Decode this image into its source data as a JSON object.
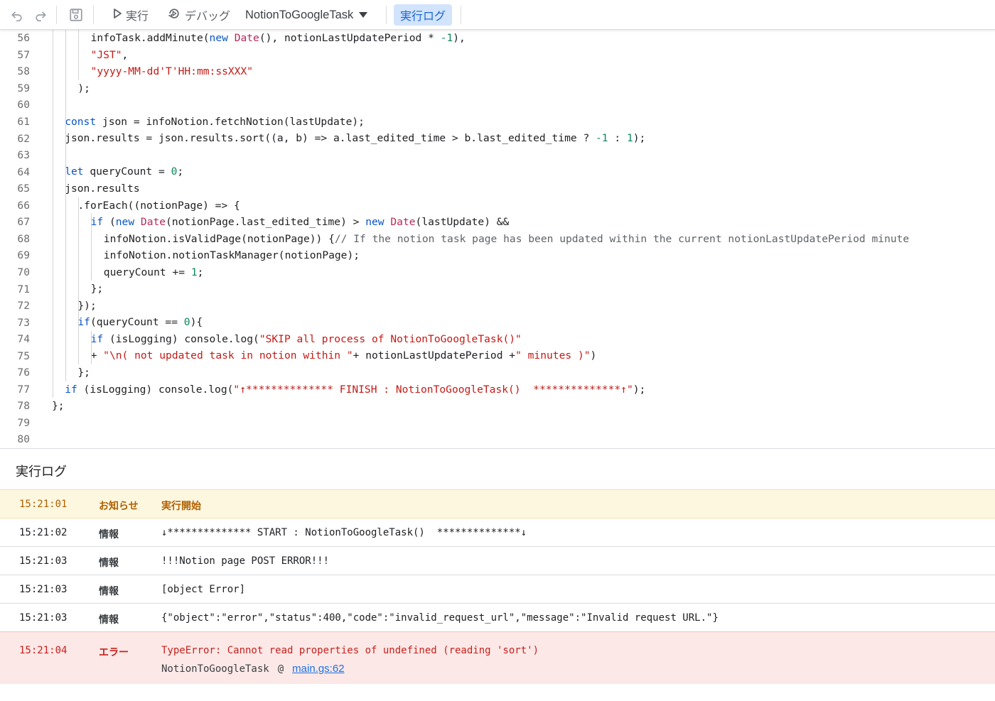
{
  "toolbar": {
    "run_label": "実行",
    "debug_label": "デバッグ",
    "function_name": "NotionToGoogleTask",
    "log_label": "実行ログ"
  },
  "code_lines": [
    {
      "n": "56",
      "indent": 3,
      "tokens": [
        [
          "p",
          "infoTask.addMinute("
        ],
        [
          "k",
          "new"
        ],
        [
          "p",
          " "
        ],
        [
          "t",
          "Date"
        ],
        [
          "p",
          "(), notionLastUpdatePeriod * "
        ],
        [
          "n",
          "-1"
        ],
        [
          "p",
          "),"
        ]
      ]
    },
    {
      "n": "57",
      "indent": 3,
      "tokens": [
        [
          "s",
          "\"JST\""
        ],
        [
          "p",
          ","
        ]
      ]
    },
    {
      "n": "58",
      "indent": 3,
      "tokens": [
        [
          "s",
          "\"yyyy-MM-dd'T'HH:mm:ssXXX\""
        ]
      ]
    },
    {
      "n": "59",
      "indent": 2,
      "tokens": [
        [
          "p",
          ");"
        ]
      ]
    },
    {
      "n": "60",
      "indent": 0,
      "tokens": []
    },
    {
      "n": "61",
      "indent": 1,
      "tokens": [
        [
          "k",
          "const"
        ],
        [
          "p",
          " json = infoNotion.fetchNotion(lastUpdate);"
        ]
      ]
    },
    {
      "n": "62",
      "indent": 1,
      "tokens": [
        [
          "p",
          "json.results = json.results.sort((a, b) => a.last_edited_time > b.last_edited_time ? "
        ],
        [
          "n",
          "-1"
        ],
        [
          "p",
          " : "
        ],
        [
          "n",
          "1"
        ],
        [
          "p",
          ");"
        ]
      ]
    },
    {
      "n": "63",
      "indent": 0,
      "tokens": []
    },
    {
      "n": "64",
      "indent": 1,
      "tokens": [
        [
          "k",
          "let"
        ],
        [
          "p",
          " queryCount = "
        ],
        [
          "n",
          "0"
        ],
        [
          "p",
          ";"
        ]
      ]
    },
    {
      "n": "65",
      "indent": 1,
      "tokens": [
        [
          "p",
          "json.results"
        ]
      ]
    },
    {
      "n": "66",
      "indent": 2,
      "tokens": [
        [
          "p",
          ".forEach((notionPage) => {"
        ]
      ]
    },
    {
      "n": "67",
      "indent": 3,
      "tokens": [
        [
          "k",
          "if"
        ],
        [
          "p",
          " ("
        ],
        [
          "k",
          "new"
        ],
        [
          "p",
          " "
        ],
        [
          "t",
          "Date"
        ],
        [
          "p",
          "(notionPage.last_edited_time) > "
        ],
        [
          "k",
          "new"
        ],
        [
          "p",
          " "
        ],
        [
          "t",
          "Date"
        ],
        [
          "p",
          "(lastUpdate) &&"
        ]
      ]
    },
    {
      "n": "68",
      "indent": 4,
      "tokens": [
        [
          "p",
          "infoNotion.isValidPage(notionPage)) {"
        ],
        [
          "c",
          "// If the notion task page has been updated within the current notionLastUpdatePeriod minute"
        ]
      ]
    },
    {
      "n": "69",
      "indent": 4,
      "tokens": [
        [
          "p",
          "infoNotion.notionTaskManager(notionPage);"
        ]
      ]
    },
    {
      "n": "70",
      "indent": 4,
      "tokens": [
        [
          "p",
          "queryCount += "
        ],
        [
          "n",
          "1"
        ],
        [
          "p",
          ";"
        ]
      ]
    },
    {
      "n": "71",
      "indent": 3,
      "tokens": [
        [
          "p",
          "};"
        ]
      ]
    },
    {
      "n": "72",
      "indent": 2,
      "tokens": [
        [
          "p",
          "});"
        ]
      ]
    },
    {
      "n": "73",
      "indent": 2,
      "tokens": [
        [
          "k",
          "if"
        ],
        [
          "p",
          "(queryCount == "
        ],
        [
          "n",
          "0"
        ],
        [
          "p",
          "){"
        ]
      ]
    },
    {
      "n": "74",
      "indent": 3,
      "tokens": [
        [
          "k",
          "if"
        ],
        [
          "p",
          " (isLogging) console.log("
        ],
        [
          "s",
          "\"SKIP all process of NotionToGoogleTask()\""
        ]
      ]
    },
    {
      "n": "75",
      "indent": 3,
      "tokens": [
        [
          "p",
          "+ "
        ],
        [
          "s",
          "\"\\n( not updated task in notion within \""
        ],
        [
          "p",
          "+ notionLastUpdatePeriod +"
        ],
        [
          "s",
          "\" minutes )\""
        ],
        [
          "p",
          ")"
        ]
      ]
    },
    {
      "n": "76",
      "indent": 2,
      "tokens": [
        [
          "p",
          "};"
        ]
      ]
    },
    {
      "n": "77",
      "indent": 1,
      "tokens": [
        [
          "k",
          "if"
        ],
        [
          "p",
          " (isLogging) console.log("
        ],
        [
          "s",
          "\"↑************** FINISH : NotionToGoogleTask()  **************↑\""
        ],
        [
          "p",
          ");"
        ]
      ]
    },
    {
      "n": "78",
      "indent": 0.5,
      "tokens": [
        [
          "p",
          "};"
        ]
      ]
    },
    {
      "n": "79",
      "indent": 0,
      "tokens": []
    },
    {
      "n": "80",
      "indent": 0,
      "tokens": []
    }
  ],
  "log": {
    "title": "実行ログ",
    "entries": [
      {
        "time": "15:21:01",
        "level": "お知らせ",
        "message": "実行開始",
        "kind": "notice"
      },
      {
        "time": "15:21:02",
        "level": "情報",
        "message": "↓************** START : NotionToGoogleTask()  **************↓",
        "kind": "info"
      },
      {
        "time": "15:21:03",
        "level": "情報",
        "message": "!!!Notion page POST ERROR!!!",
        "kind": "info"
      },
      {
        "time": "15:21:03",
        "level": "情報",
        "message": "[object Error]",
        "kind": "info"
      },
      {
        "time": "15:21:03",
        "level": "情報",
        "message": "{\"object\":\"error\",\"status\":400,\"code\":\"invalid_request_url\",\"message\":\"Invalid request URL.\"}",
        "kind": "info"
      },
      {
        "time": "15:21:04",
        "level": "エラー",
        "message": "TypeError: Cannot read properties of undefined (reading 'sort')",
        "kind": "error"
      }
    ],
    "error_stack": {
      "function": "NotionToGoogleTask",
      "at": "@",
      "location": "main.gs:62"
    }
  },
  "colors": {
    "accent": "#1a73e8",
    "notice_bg": "#fef7e0",
    "error_bg": "#fce8e6",
    "error_text": "#c5221f",
    "notice_text": "#b06000"
  }
}
